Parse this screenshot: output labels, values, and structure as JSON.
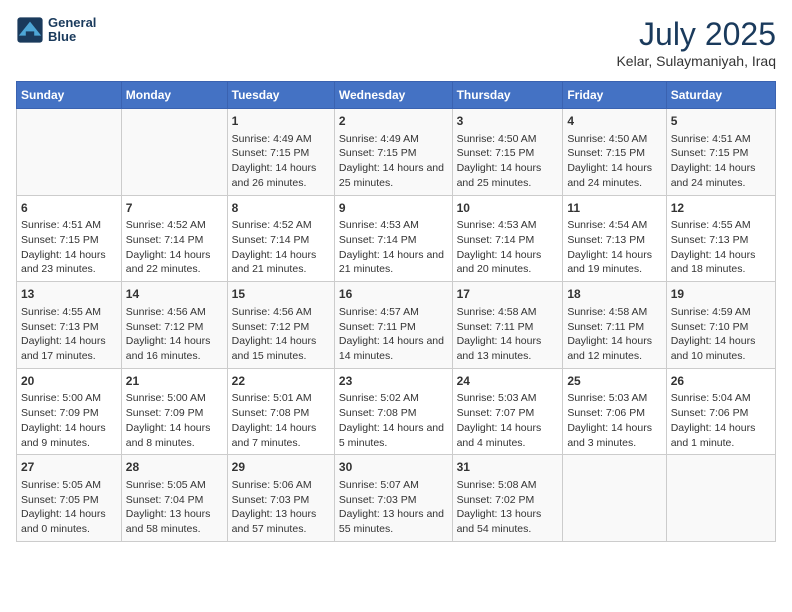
{
  "header": {
    "logo_line1": "General",
    "logo_line2": "Blue",
    "main_title": "July 2025",
    "subtitle": "Kelar, Sulaymaniyah, Iraq"
  },
  "calendar": {
    "days_of_week": [
      "Sunday",
      "Monday",
      "Tuesday",
      "Wednesday",
      "Thursday",
      "Friday",
      "Saturday"
    ],
    "weeks": [
      [
        {
          "day": "",
          "content": ""
        },
        {
          "day": "",
          "content": ""
        },
        {
          "day": "1",
          "content": "Sunrise: 4:49 AM\nSunset: 7:15 PM\nDaylight: 14 hours and 26 minutes."
        },
        {
          "day": "2",
          "content": "Sunrise: 4:49 AM\nSunset: 7:15 PM\nDaylight: 14 hours and 25 minutes."
        },
        {
          "day": "3",
          "content": "Sunrise: 4:50 AM\nSunset: 7:15 PM\nDaylight: 14 hours and 25 minutes."
        },
        {
          "day": "4",
          "content": "Sunrise: 4:50 AM\nSunset: 7:15 PM\nDaylight: 14 hours and 24 minutes."
        },
        {
          "day": "5",
          "content": "Sunrise: 4:51 AM\nSunset: 7:15 PM\nDaylight: 14 hours and 24 minutes."
        }
      ],
      [
        {
          "day": "6",
          "content": "Sunrise: 4:51 AM\nSunset: 7:15 PM\nDaylight: 14 hours and 23 minutes."
        },
        {
          "day": "7",
          "content": "Sunrise: 4:52 AM\nSunset: 7:14 PM\nDaylight: 14 hours and 22 minutes."
        },
        {
          "day": "8",
          "content": "Sunrise: 4:52 AM\nSunset: 7:14 PM\nDaylight: 14 hours and 21 minutes."
        },
        {
          "day": "9",
          "content": "Sunrise: 4:53 AM\nSunset: 7:14 PM\nDaylight: 14 hours and 21 minutes."
        },
        {
          "day": "10",
          "content": "Sunrise: 4:53 AM\nSunset: 7:14 PM\nDaylight: 14 hours and 20 minutes."
        },
        {
          "day": "11",
          "content": "Sunrise: 4:54 AM\nSunset: 7:13 PM\nDaylight: 14 hours and 19 minutes."
        },
        {
          "day": "12",
          "content": "Sunrise: 4:55 AM\nSunset: 7:13 PM\nDaylight: 14 hours and 18 minutes."
        }
      ],
      [
        {
          "day": "13",
          "content": "Sunrise: 4:55 AM\nSunset: 7:13 PM\nDaylight: 14 hours and 17 minutes."
        },
        {
          "day": "14",
          "content": "Sunrise: 4:56 AM\nSunset: 7:12 PM\nDaylight: 14 hours and 16 minutes."
        },
        {
          "day": "15",
          "content": "Sunrise: 4:56 AM\nSunset: 7:12 PM\nDaylight: 14 hours and 15 minutes."
        },
        {
          "day": "16",
          "content": "Sunrise: 4:57 AM\nSunset: 7:11 PM\nDaylight: 14 hours and 14 minutes."
        },
        {
          "day": "17",
          "content": "Sunrise: 4:58 AM\nSunset: 7:11 PM\nDaylight: 14 hours and 13 minutes."
        },
        {
          "day": "18",
          "content": "Sunrise: 4:58 AM\nSunset: 7:11 PM\nDaylight: 14 hours and 12 minutes."
        },
        {
          "day": "19",
          "content": "Sunrise: 4:59 AM\nSunset: 7:10 PM\nDaylight: 14 hours and 10 minutes."
        }
      ],
      [
        {
          "day": "20",
          "content": "Sunrise: 5:00 AM\nSunset: 7:09 PM\nDaylight: 14 hours and 9 minutes."
        },
        {
          "day": "21",
          "content": "Sunrise: 5:00 AM\nSunset: 7:09 PM\nDaylight: 14 hours and 8 minutes."
        },
        {
          "day": "22",
          "content": "Sunrise: 5:01 AM\nSunset: 7:08 PM\nDaylight: 14 hours and 7 minutes."
        },
        {
          "day": "23",
          "content": "Sunrise: 5:02 AM\nSunset: 7:08 PM\nDaylight: 14 hours and 5 minutes."
        },
        {
          "day": "24",
          "content": "Sunrise: 5:03 AM\nSunset: 7:07 PM\nDaylight: 14 hours and 4 minutes."
        },
        {
          "day": "25",
          "content": "Sunrise: 5:03 AM\nSunset: 7:06 PM\nDaylight: 14 hours and 3 minutes."
        },
        {
          "day": "26",
          "content": "Sunrise: 5:04 AM\nSunset: 7:06 PM\nDaylight: 14 hours and 1 minute."
        }
      ],
      [
        {
          "day": "27",
          "content": "Sunrise: 5:05 AM\nSunset: 7:05 PM\nDaylight: 14 hours and 0 minutes."
        },
        {
          "day": "28",
          "content": "Sunrise: 5:05 AM\nSunset: 7:04 PM\nDaylight: 13 hours and 58 minutes."
        },
        {
          "day": "29",
          "content": "Sunrise: 5:06 AM\nSunset: 7:03 PM\nDaylight: 13 hours and 57 minutes."
        },
        {
          "day": "30",
          "content": "Sunrise: 5:07 AM\nSunset: 7:03 PM\nDaylight: 13 hours and 55 minutes."
        },
        {
          "day": "31",
          "content": "Sunrise: 5:08 AM\nSunset: 7:02 PM\nDaylight: 13 hours and 54 minutes."
        },
        {
          "day": "",
          "content": ""
        },
        {
          "day": "",
          "content": ""
        }
      ]
    ]
  }
}
